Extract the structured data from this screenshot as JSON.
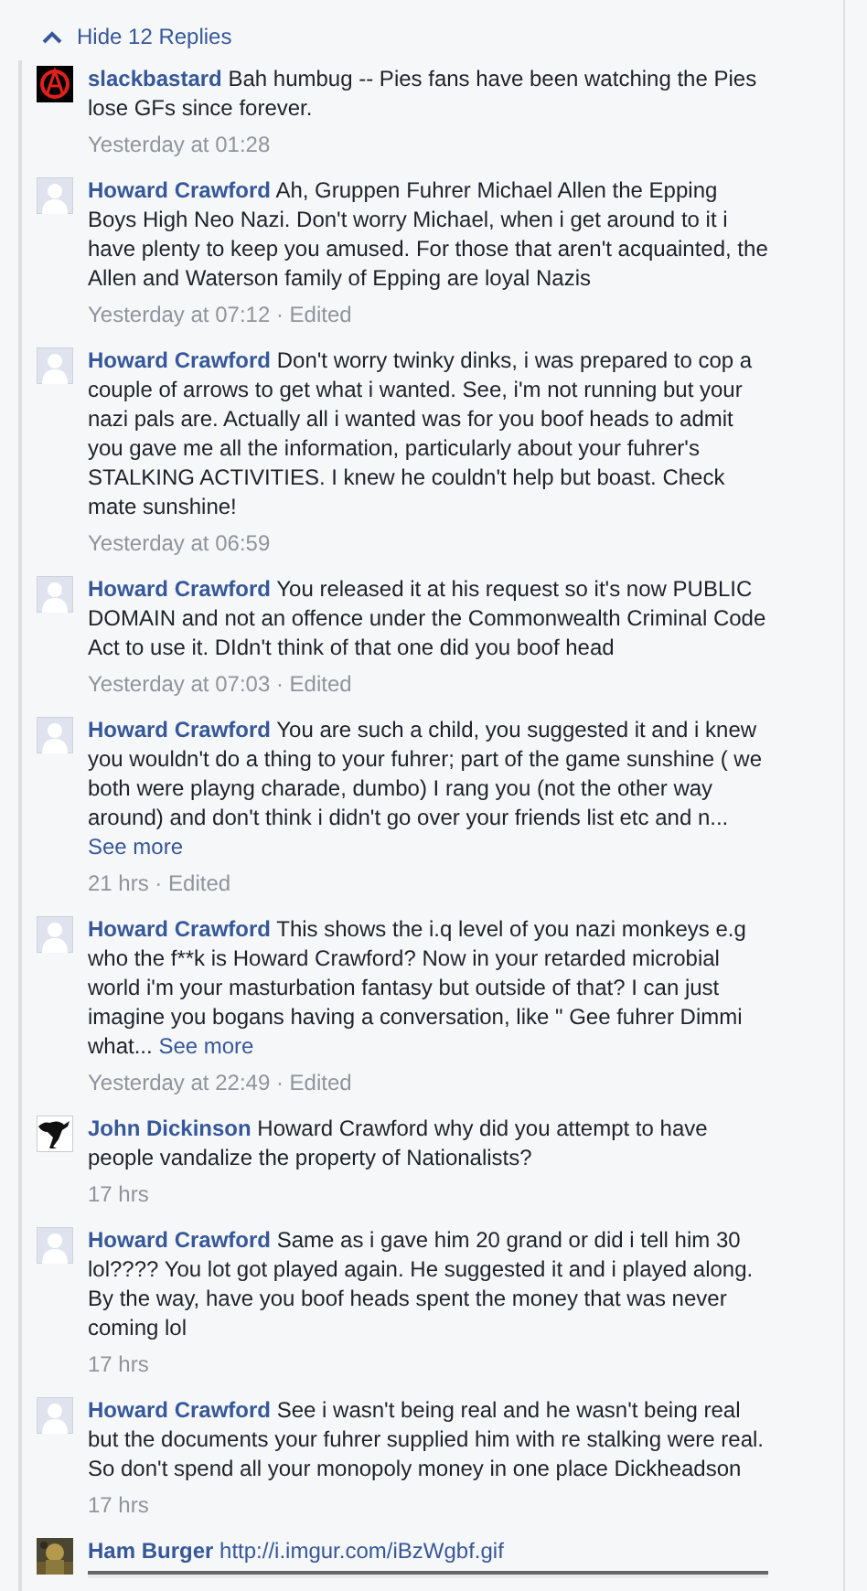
{
  "toggle": {
    "label": "Hide 12 Replies"
  },
  "comments": [
    {
      "kind": "anarchy",
      "author": "slackbastard",
      "text": "Bah humbug -- Pies fans have been watching the Pies lose GFs since forever.",
      "meta": "Yesterday at 01:28"
    },
    {
      "kind": "default",
      "author": "Howard Crawford",
      "text": "Ah, Gruppen Fuhrer Michael Allen the Epping Boys High Neo Nazi. Don't worry Michael, when i get around to it i have plenty to keep you amused. For those that aren't acquainted, the Allen and Waterson family of Epping are loyal Nazis",
      "meta": "Yesterday at 07:12 · Edited"
    },
    {
      "kind": "default",
      "author": "Howard Crawford",
      "text": "Don't worry twinky dinks, i was prepared to cop a couple of arrows to get what i wanted. See, i'm not running but your nazi pals are. Actually all i wanted was for you boof heads to admit you gave me all the information, particularly about your fuhrer's STALKING ACTIVITIES. I knew he couldn't help but boast. Check mate sunshine!",
      "meta": "Yesterday at 06:59"
    },
    {
      "kind": "default",
      "author": "Howard Crawford",
      "text": "You released it at his request so it's now PUBLIC DOMAIN and not an offence under the Commonwealth Criminal Code Act to use it. DIdn't think of that one did you boof head",
      "meta": "Yesterday at 07:03 · Edited"
    },
    {
      "kind": "default",
      "author": "Howard Crawford",
      "text": "You are such a child, you suggested it and i knew you wouldn't do a thing to your fuhrer; part of the game sunshine ( we both were playng charade, dumbo) I rang you (not the other way around) and don't think i didn't go over your friends list etc and n...",
      "more": "See more",
      "meta": "21 hrs · Edited"
    },
    {
      "kind": "default",
      "author": "Howard Crawford",
      "text": "This shows the i.q level of you nazi monkeys e.g who the f**k is Howard Crawford? Now in your retarded microbial world i'm your masturbation fantasy but outside of that? I can just imagine you bogans having a conversation, like \" Gee fuhrer Dimmi what...",
      "more": "See more",
      "meta": "Yesterday at 22:49 · Edited"
    },
    {
      "kind": "kangaroo",
      "author": "John Dickinson",
      "text": "Howard Crawford why did you attempt to have people vandalize the property of Nationalists?",
      "meta": "17 hrs"
    },
    {
      "kind": "default",
      "author": "Howard Crawford",
      "text": "Same as i gave him 20 grand or did i tell him 30 lol???? You lot got played again. He suggested it and i played along. By the way, have you boof heads spent the money that was never coming lol",
      "meta": "17 hrs"
    },
    {
      "kind": "default",
      "author": "Howard Crawford",
      "text": "See i wasn't being real and he wasn't being real but the documents your fuhrer supplied him with re stalking were real. So don't spend all your monopoly money in one place Dickheadson",
      "meta": "17 hrs"
    },
    {
      "kind": "picture",
      "author": "Ham Burger",
      "link": "http://i.imgur.com/iBzWgbf.gif",
      "attachment": true
    }
  ]
}
